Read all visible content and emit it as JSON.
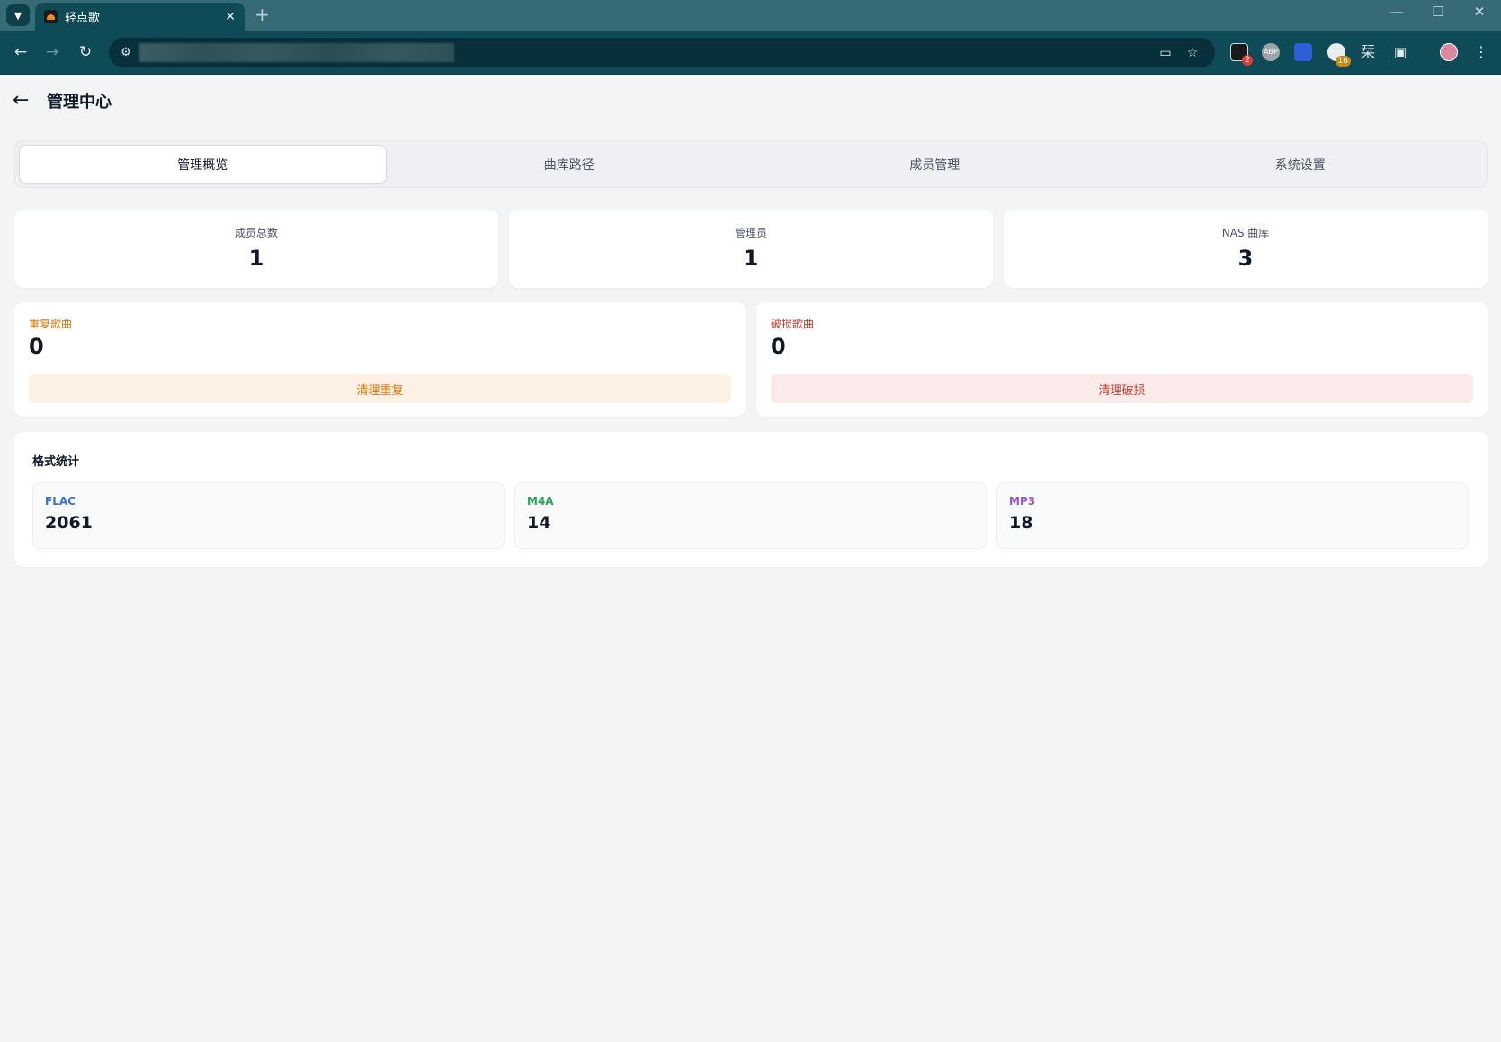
{
  "browser": {
    "tab_title": "轻点歌",
    "new_tab_label": "+",
    "window_controls": {
      "minimize": "—",
      "maximize": "☐",
      "close": "✕"
    },
    "extensions": [
      {
        "name": "extension-1-icon",
        "badge": "2",
        "badge_color": "#e53935"
      },
      {
        "name": "abp-icon",
        "label": "ABP",
        "badge": ""
      },
      {
        "name": "extension-3-icon",
        "badge": ""
      },
      {
        "name": "extension-4-icon",
        "badge": "16",
        "badge_color": "#c98a1a"
      },
      {
        "name": "extension-5-icon",
        "label": "栞",
        "badge": ""
      }
    ]
  },
  "header": {
    "title": "管理中心"
  },
  "tabs": [
    {
      "label": "管理概览",
      "active": true
    },
    {
      "label": "曲库路径",
      "active": false
    },
    {
      "label": "成员管理",
      "active": false
    },
    {
      "label": "系统设置",
      "active": false
    }
  ],
  "stats": [
    {
      "label": "成员总数",
      "value": "1"
    },
    {
      "label": "管理员",
      "value": "1"
    },
    {
      "label": "NAS 曲库",
      "value": "3"
    }
  ],
  "issues": {
    "duplicate": {
      "label": "重复歌曲",
      "value": "0",
      "button": "清理重复",
      "color": "#d97706",
      "bg": "#fdf0e4"
    },
    "broken": {
      "label": "破损歌曲",
      "value": "0",
      "button": "清理破损",
      "color": "#c0392b",
      "bg": "#fbeaea"
    }
  },
  "formats": {
    "title": "格式统计",
    "items": [
      {
        "label": "FLAC",
        "value": "2061",
        "color": "#3b6fd6"
      },
      {
        "label": "M4A",
        "value": "14",
        "color": "#22a559"
      },
      {
        "label": "MP3",
        "value": "18",
        "color": "#9b4fd1"
      }
    ]
  }
}
